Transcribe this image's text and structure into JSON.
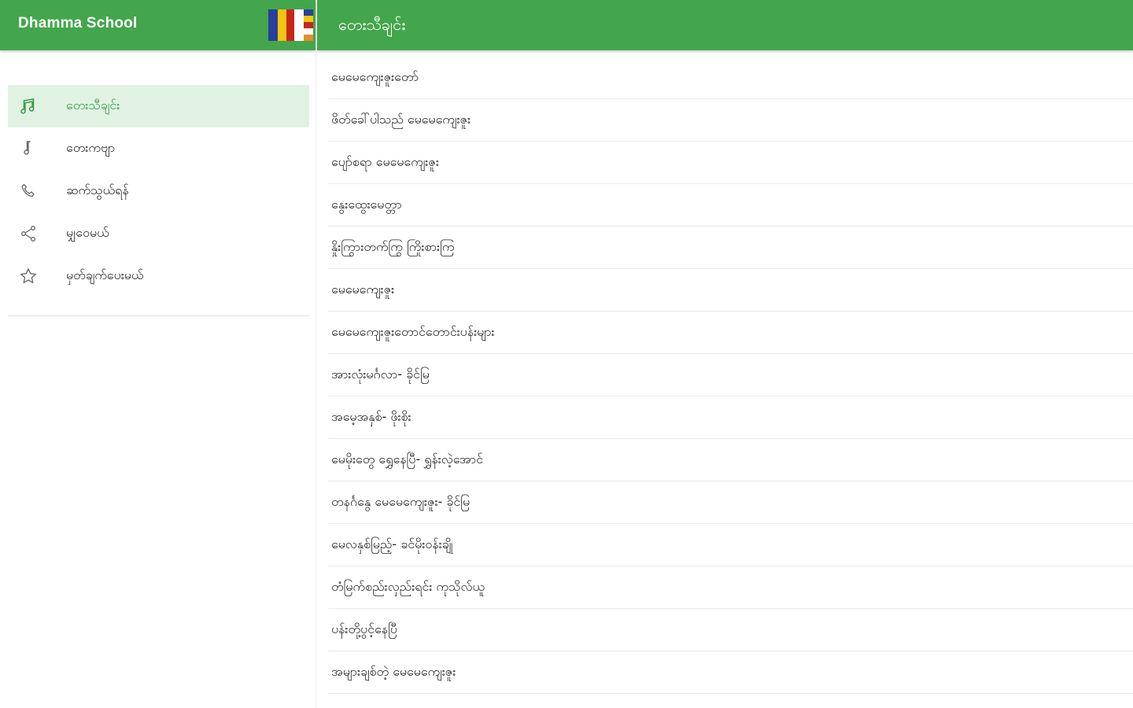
{
  "app": {
    "title": "Dhamma School",
    "theme_color": "#43a64c",
    "active_tint": "#e1f2e3"
  },
  "sidebar": {
    "items": [
      {
        "label": "တေးသီချင်း",
        "icon": "music-note-icon",
        "active": true
      },
      {
        "label": "တေးကဗျာ",
        "icon": "single-note-icon",
        "active": false
      },
      {
        "label": "ဆက်သွယ်ရန်",
        "icon": "phone-icon",
        "active": false
      },
      {
        "label": "မျှဝေမယ်",
        "icon": "share-icon",
        "active": false
      },
      {
        "label": "မှတ်ချက်ပေးမယ်",
        "icon": "star-icon",
        "active": false
      }
    ]
  },
  "main": {
    "title": "တေးသီချင်း",
    "songs": [
      "မေမေကျေးဇူးတော်",
      "ဖိတ်ခေါ်ပါသည် မေမေကျေးဇူး",
      "ပျော်စရာ မေမေကျေးဇူး",
      "နွေးထွေးမေတ္တာ",
      "နှိုးကြွားတက်ကြွ ကြိုးစားကြ",
      "မေမေကျေးဇူး",
      "မေမေကျေးဇူးတောင်တောင်းပန်းများ",
      "အားလုံးမင်္ဂလာ- ခိုင်မြ",
      "အမေ့အနှစ်- ဖိုးစိုး",
      "မေမိုးတွေ ရွှေနေပြီ- ရွှန်းလဲ့အောင်",
      "တနင်္ဂနွေ မေမေကျေးဇူး- ခိုင်မြ",
      "မေလနှစ်မြည့်- ခင်မိုးဝန်းချို",
      "တံမြက်စည်းလှည်းရင်း ကုသိုလ်ယူ",
      "ပန်းတို့ပွင့်နေပြီ",
      "အများချစ်တဲ့ မေမေကျေးဇူး"
    ]
  }
}
